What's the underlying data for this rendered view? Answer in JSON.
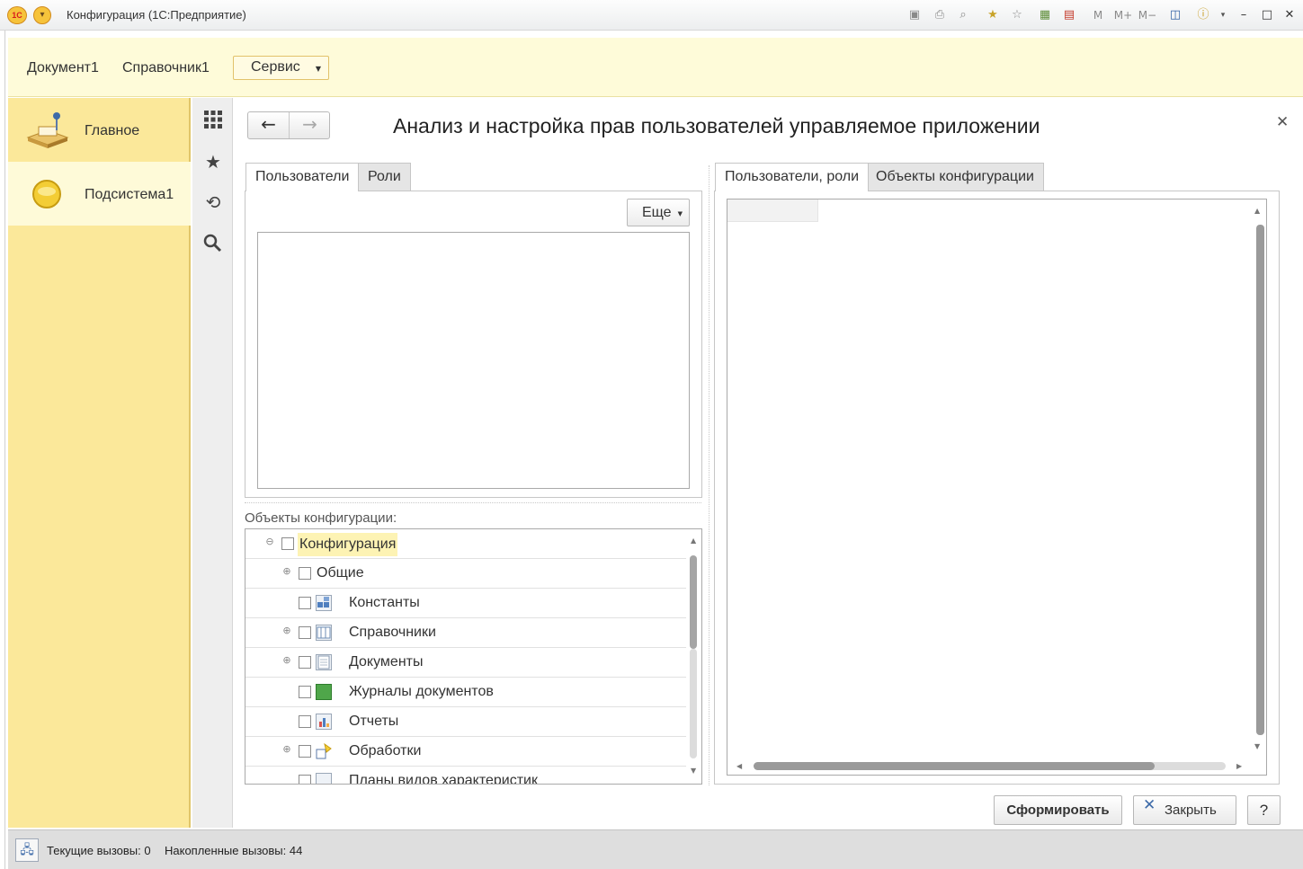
{
  "window": {
    "title": "Конфигурация  (1С:Предприятие)",
    "logo_text": "1С"
  },
  "menubar": {
    "items": [
      "Документ1",
      "Справочник1"
    ],
    "service_label": "Сервис"
  },
  "sections": [
    {
      "label": "Главное",
      "icon": "main-section-icon",
      "active": false
    },
    {
      "label": "Подсистема1",
      "icon": "subsystem-icon",
      "active": true
    }
  ],
  "form": {
    "title": "Анализ и настройка прав пользователей управляемое приложении",
    "left_tabs": [
      "Пользователи",
      "Роли"
    ],
    "more_label": "Еще",
    "config_caption": "Объекты конфигурации:",
    "right_tabs": [
      "Пользователи, роли",
      "Объекты конфигурации"
    ],
    "generate_label": "Сформировать",
    "close_label": "Закрыть",
    "help_label": "?"
  },
  "tree": [
    {
      "label": "Конфигурация",
      "level": 0,
      "expander": "minus",
      "icon": "none",
      "highlighted": true
    },
    {
      "label": "Общие",
      "level": 1,
      "expander": "plus",
      "icon": "none",
      "highlighted": false
    },
    {
      "label": "Константы",
      "level": 1,
      "expander": "none",
      "icon": "constants-icon",
      "highlighted": false
    },
    {
      "label": "Справочники",
      "level": 1,
      "expander": "plus",
      "icon": "catalogs-icon",
      "highlighted": false
    },
    {
      "label": "Документы",
      "level": 1,
      "expander": "plus",
      "icon": "documents-icon",
      "highlighted": false
    },
    {
      "label": "Журналы документов",
      "level": 1,
      "expander": "none",
      "icon": "journals-icon",
      "highlighted": false
    },
    {
      "label": "Отчеты",
      "level": 1,
      "expander": "none",
      "icon": "reports-icon",
      "highlighted": false
    },
    {
      "label": "Обработки",
      "level": 1,
      "expander": "plus",
      "icon": "processings-icon",
      "highlighted": false
    },
    {
      "label": "Планы видов характеристик",
      "level": 1,
      "expander": "none",
      "icon": "chart-of-characteristics-icon",
      "highlighted": false
    }
  ],
  "status": {
    "current_calls": "Текущие вызовы: 0",
    "accumulated_calls": "Накопленные вызовы: 44"
  },
  "colors": {
    "sections_bg": "#fbe89a",
    "menubar_bg": "#fefbd9",
    "highlight": "#fdf3b4"
  }
}
